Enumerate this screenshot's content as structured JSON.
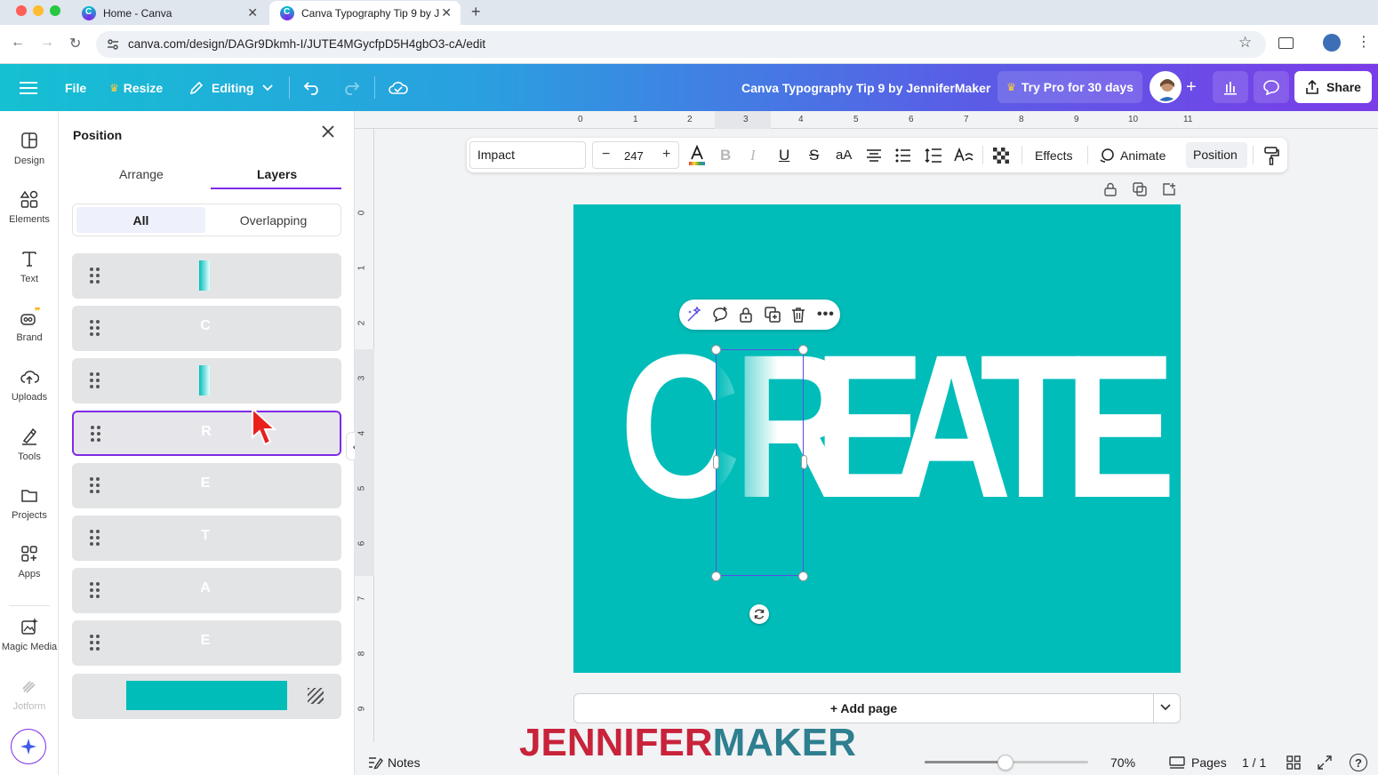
{
  "browser": {
    "tabs": [
      {
        "title": "Home - Canva"
      },
      {
        "title": "Canva Typography Tip 9 by J"
      }
    ],
    "url": "canva.com/design/DAGr9Dkmh-I/JUTE4MGycfpD5H4gbO3-cA/edit"
  },
  "header": {
    "file": "File",
    "resize": "Resize",
    "editing": "Editing",
    "doc_title": "Canva Typography Tip 9 by JenniferMaker",
    "try_pro": "Try Pro for 30 days",
    "share": "Share"
  },
  "rail": [
    {
      "label": "Design",
      "icon": "design-icon"
    },
    {
      "label": "Elements",
      "icon": "elements-icon"
    },
    {
      "label": "Text",
      "icon": "text-icon"
    },
    {
      "label": "Brand",
      "icon": "brand-icon"
    },
    {
      "label": "Uploads",
      "icon": "uploads-icon"
    },
    {
      "label": "Tools",
      "icon": "tools-icon"
    },
    {
      "label": "Projects",
      "icon": "projects-icon"
    },
    {
      "label": "Apps",
      "icon": "apps-icon"
    },
    {
      "label": "Magic Media",
      "icon": "magic-media-icon"
    },
    {
      "label": "Jotform",
      "icon": "jotform-icon"
    }
  ],
  "panel": {
    "title": "Position",
    "tabs": [
      "Arrange",
      "Layers"
    ],
    "active_tab": "Layers",
    "filters": [
      "All",
      "Overlapping"
    ],
    "active_filter": "All",
    "layers": [
      {
        "kind": "gradient"
      },
      {
        "kind": "letter",
        "glyph": "C"
      },
      {
        "kind": "gradient"
      },
      {
        "kind": "letter",
        "glyph": "R",
        "selected": true
      },
      {
        "kind": "letter",
        "glyph": "E"
      },
      {
        "kind": "letter",
        "glyph": "T"
      },
      {
        "kind": "letter",
        "glyph": "A"
      },
      {
        "kind": "letter",
        "glyph": "E"
      },
      {
        "kind": "background"
      }
    ]
  },
  "ruler": {
    "h": [
      "0",
      "1",
      "2",
      "3",
      "4",
      "5",
      "6",
      "7",
      "8",
      "9",
      "10",
      "11"
    ],
    "v": [
      "0",
      "1",
      "2",
      "3",
      "4",
      "5",
      "6",
      "7",
      "8",
      "9"
    ]
  },
  "toolbar": {
    "font": "Impact",
    "size": "247",
    "effects": "Effects",
    "animate": "Animate",
    "position": "Position"
  },
  "canvas": {
    "background_color": "#00bdb9",
    "word": [
      "C",
      "R",
      "E",
      "A",
      "T",
      "E"
    ]
  },
  "footer": {
    "add_page": "+ Add page",
    "notes": "Notes",
    "zoom": "70%",
    "pages": "Pages",
    "page_count": "1 / 1"
  },
  "watermark": {
    "part1": "JENNIFER",
    "part2": "MAKER"
  },
  "colors": {
    "accent": "#7d2ae8",
    "canvas_teal": "#00bdb9",
    "watermark_red": "#c8233a",
    "watermark_teal": "#2e7f8f"
  }
}
